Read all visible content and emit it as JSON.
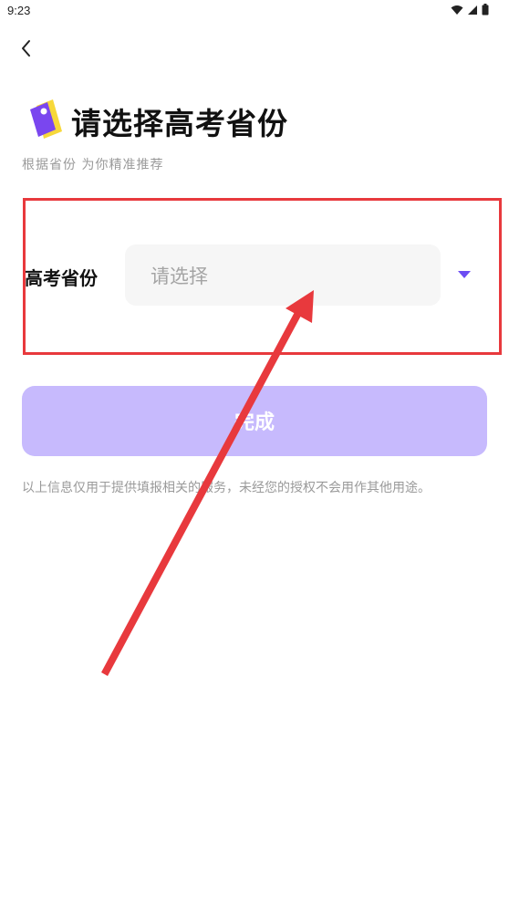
{
  "status_bar": {
    "time": "9:23"
  },
  "header": {
    "title": "请选择高考省份",
    "subtitle": "根据省份 为你精准推荐"
  },
  "form": {
    "province_label": "高考省份",
    "province_placeholder": "请选择"
  },
  "actions": {
    "done_label": "完成"
  },
  "footer": {
    "privacy_note": "以上信息仅用于提供填报相关的服务，未经您的授权不会用作其他用途。"
  },
  "colors": {
    "accent": "#6c4df3",
    "button_disabled": "#c7bafd",
    "annotation_red": "#e8393d"
  },
  "icons": {
    "back": "chevron-left-icon",
    "title": "tag-icon",
    "dropdown": "caret-down-icon"
  }
}
